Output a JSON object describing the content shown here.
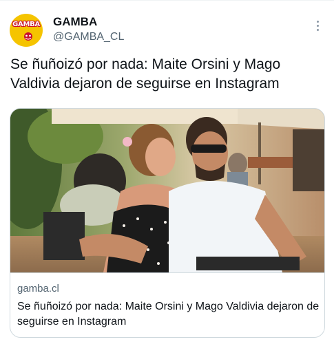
{
  "author": {
    "display_name": "GAMBA",
    "handle": "@GAMBA_CL",
    "avatar_text": "GAMBA",
    "avatar_colors": {
      "background": "#f5c400",
      "text": "#ffffff",
      "outline": "#c8102e"
    }
  },
  "tweet": {
    "text": "Se ñuñoizó por nada: Maite Orsini y Mago Valdivia dejaron de seguirse en Instagram"
  },
  "link_card": {
    "domain": "gamba.cl",
    "title": "Se ñuñoizó por nada: Maite Orsini y Mago Valdivia dejaron de seguirse en Instagram",
    "image_description_icon": "photo-couple"
  },
  "icons": {
    "more": "more-dots-icon"
  },
  "colors": {
    "text_primary": "#0f1419",
    "text_secondary": "#536471",
    "border": "#cfd9de"
  }
}
